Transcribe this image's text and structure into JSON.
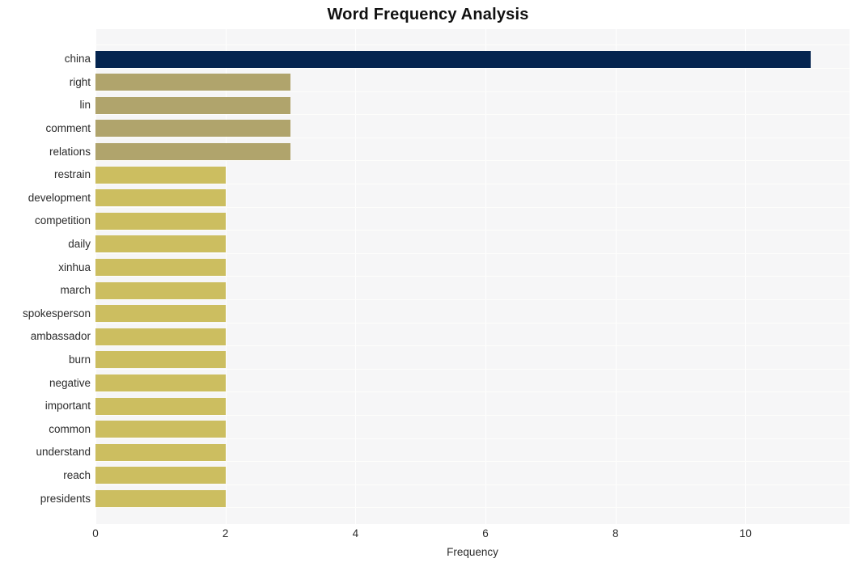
{
  "chart_data": {
    "type": "bar",
    "orientation": "horizontal",
    "title": "Word Frequency Analysis",
    "xlabel": "Frequency",
    "ylabel": "",
    "xlim": [
      0,
      11.6
    ],
    "ylim": null,
    "grid": true,
    "legend": false,
    "legend_position": "none",
    "xticks": [
      "0",
      "2",
      "4",
      "6",
      "8",
      "10"
    ],
    "xtick_values": [
      0,
      2,
      4,
      6,
      8,
      10
    ],
    "categories": [
      "china",
      "right",
      "lin",
      "comment",
      "relations",
      "restrain",
      "development",
      "competition",
      "daily",
      "xinhua",
      "march",
      "spokesperson",
      "ambassador",
      "burn",
      "negative",
      "important",
      "common",
      "understand",
      "reach",
      "presidents"
    ],
    "values": [
      11,
      3,
      3,
      3,
      3,
      2,
      2,
      2,
      2,
      2,
      2,
      2,
      2,
      2,
      2,
      2,
      2,
      2,
      2,
      2
    ],
    "bar_colors": [
      "#04244f",
      "#b0a46c",
      "#b0a46c",
      "#b0a46c",
      "#b0a46c",
      "#ccbe60",
      "#ccbe60",
      "#ccbe60",
      "#ccbe60",
      "#ccbe60",
      "#ccbe60",
      "#ccbe60",
      "#ccbe60",
      "#ccbe60",
      "#ccbe60",
      "#ccbe60",
      "#ccbe60",
      "#ccbe60",
      "#ccbe60",
      "#ccbe60"
    ]
  },
  "style": {
    "plot_background": "#f6f6f7",
    "figure_background": "#ffffff",
    "gridline_color": "#ffffff",
    "text_color": "#2b2b2b",
    "title_color": "#111111",
    "accent_color": "#04244f"
  }
}
